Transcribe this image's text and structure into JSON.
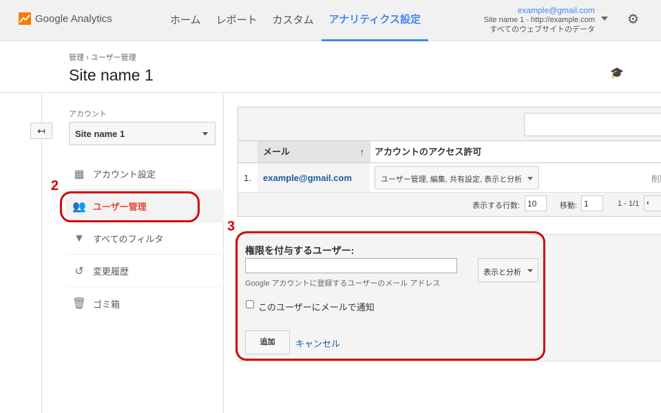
{
  "header": {
    "brand": "Google Analytics",
    "nav": [
      "ホーム",
      "レポート",
      "カスタム",
      "アナリティクス設定"
    ],
    "active_nav": 3,
    "account_email": "example@gmail.com",
    "account_property": "Site name 1 - http://example.com",
    "account_view": "すべてのウェブサイトのデータ"
  },
  "page": {
    "breadcrumb_root": "管理",
    "breadcrumb_sep": "›",
    "breadcrumb_current": "ユーザー管理",
    "title": "Site name 1"
  },
  "sidebar": {
    "account_label": "アカウント",
    "account_value": "Site name 1",
    "items": [
      {
        "label": "アカウント設定",
        "icon": "building-icon"
      },
      {
        "label": "ユーザー管理",
        "icon": "users-icon"
      },
      {
        "label": "すべてのフィルタ",
        "icon": "filter-icon"
      },
      {
        "label": "変更履歴",
        "icon": "history-icon"
      },
      {
        "label": "ゴミ箱",
        "icon": "trash-icon"
      }
    ],
    "selected": 1
  },
  "annotations": {
    "step2": "2",
    "step3": "3",
    "highlight_color": "#d50000"
  },
  "table": {
    "columns": [
      "メール",
      "アカウントのアクセス許可"
    ],
    "rows": [
      {
        "index": "1.",
        "email": "example@gmail.com",
        "permissions": "ユーザー管理, 編集, 共有設定, 表示と分析",
        "action": "削除"
      }
    ],
    "rows_label": "表示する行数:",
    "rows_value": "10",
    "goto_label": "移動:",
    "goto_value": "1",
    "range": "1 - 1/1"
  },
  "form": {
    "title": "権限を付与するユーザー:",
    "email_value": "",
    "hint": "Google アカウントに登録するユーザーのメール アドレス",
    "permission": "表示と分析",
    "notify_label": "このユーザーにメールで通知",
    "notify_checked": false,
    "add": "追加",
    "cancel": "キャンセル"
  },
  "colors": {
    "accent": "#4285f4",
    "selected": "#e5493a"
  }
}
